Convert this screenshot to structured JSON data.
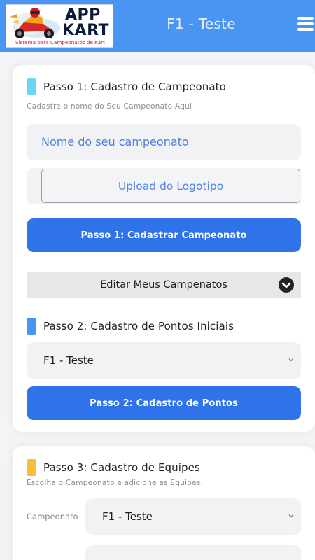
{
  "header": {
    "logo_text_line1": "APP",
    "logo_text_line2": "KART",
    "logo_tagline": "Sistema para Campeonatos de Kart",
    "title": "F1 - Teste",
    "menu_icon": "hamburger-menu-icon"
  },
  "step1": {
    "title": "Passo 1:  Cadastro de Campeonato",
    "subtitle": "Cadastre o nome do Seu Campeonato Aqui",
    "name_placeholder": "Nome do seu campeonato",
    "upload_label": "Upload do Logotipo",
    "submit_label": "Passo 1: Cadastrar Campeonato",
    "accent_color": "#6fd3f7"
  },
  "edit_section": {
    "label": "Editar Meus Campenatos",
    "icon": "chevron-down-circle-icon"
  },
  "step2": {
    "title": "Passo 2:  Cadastro de Pontos Iniciais",
    "select_value": "F1 - Teste",
    "submit_label": "Passo 2: Cadastro de Pontos",
    "accent_color": "#4b95f2"
  },
  "step3": {
    "title": "Passo 3: Cadastro de Equipes",
    "subtitle": "Escolha o Campeonato e adicione as Equipes.",
    "campeonato_label": "Campeonato",
    "campeonato_value": "F1 - Teste",
    "accent_color": "#f9bd3a"
  },
  "colors": {
    "header_bg": "#4b95f2",
    "primary_button": "#2f72ea"
  }
}
